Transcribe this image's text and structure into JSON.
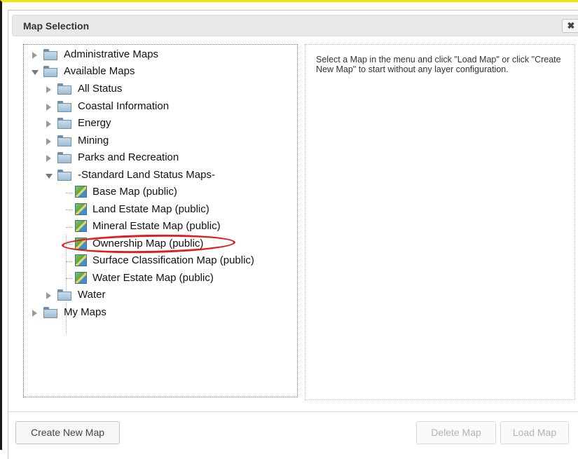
{
  "dialog": {
    "title": "Map Selection",
    "close_symbol": "✖"
  },
  "tree": [
    {
      "label": "Administrative Maps",
      "type": "folder",
      "expanded": false
    },
    {
      "label": "Available Maps",
      "type": "folder",
      "expanded": true
    },
    {
      "label": "All Status",
      "type": "folder",
      "expanded": false
    },
    {
      "label": "Coastal Information",
      "type": "folder",
      "expanded": false
    },
    {
      "label": "Energy",
      "type": "folder",
      "expanded": false
    },
    {
      "label": "Mining",
      "type": "folder",
      "expanded": false
    },
    {
      "label": "Parks and Recreation",
      "type": "folder",
      "expanded": false
    },
    {
      "label": "-Standard Land Status Maps-",
      "type": "folder",
      "expanded": true
    },
    {
      "label": "Base Map (public)",
      "type": "map"
    },
    {
      "label": "Land Estate Map (public)",
      "type": "map"
    },
    {
      "label": "Mineral Estate Map (public)",
      "type": "map"
    },
    {
      "label": "Ownership Map (public)",
      "type": "map",
      "highlighted": true
    },
    {
      "label": "Surface Classification Map (public)",
      "type": "map"
    },
    {
      "label": "Water Estate Map (public)",
      "type": "map"
    },
    {
      "label": "Water",
      "type": "folder",
      "expanded": false
    },
    {
      "label": "My Maps",
      "type": "folder",
      "expanded": false
    }
  ],
  "info": {
    "text": "Select a Map in the menu and click \"Load Map\" or click \"Create New Map\" to start without any layer configuration."
  },
  "buttons": {
    "create": "Create New Map",
    "delete": "Delete Map",
    "load": "Load Map"
  },
  "colors": {
    "highlight_ellipse": "#e01e1e",
    "frame_top": "#f2e600"
  }
}
